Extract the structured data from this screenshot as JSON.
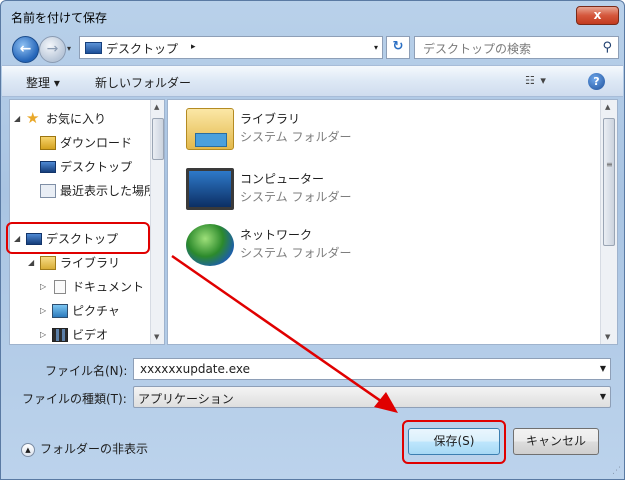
{
  "window": {
    "title": "名前を付けて保存",
    "close_glyph": "x"
  },
  "address": {
    "location": "デスクトップ",
    "arrow": "▸",
    "dropdown": "▾",
    "refresh": "↻",
    "back": "←",
    "forward": "→",
    "history": "▾"
  },
  "search": {
    "placeholder": "デスクトップの検索",
    "icon": "search-icon"
  },
  "toolbar": {
    "organize": "整理 ▾",
    "new_folder": "新しいフォルダー",
    "view": "☷ ▾",
    "help": "?"
  },
  "nav": {
    "items": [
      {
        "label": "お気に入り",
        "toggle": "◢",
        "icon": "star-icon"
      },
      {
        "label": "ダウンロード",
        "icon": "downloads-icon"
      },
      {
        "label": "デスクトップ",
        "icon": "desktop-icon"
      },
      {
        "label": "最近表示した場所",
        "icon": "recent-places-icon"
      },
      {
        "label": "デスクトップ",
        "toggle": "◢",
        "icon": "desktop-icon"
      },
      {
        "label": "ライブラリ",
        "toggle": "◢",
        "icon": "library-icon"
      },
      {
        "label": "ドキュメント",
        "toggle": "▷",
        "icon": "documents-icon"
      },
      {
        "label": "ピクチャ",
        "toggle": "▷",
        "icon": "pictures-icon"
      },
      {
        "label": "ビデオ",
        "toggle": "▷",
        "icon": "videos-icon"
      }
    ],
    "scroll_up": "▲",
    "scroll_down": "▼"
  },
  "content": {
    "items": [
      {
        "name": "ライブラリ",
        "type": "システム フォルダー",
        "icon": "library-icon"
      },
      {
        "name": "コンピューター",
        "type": "システム フォルダー",
        "icon": "computer-icon"
      },
      {
        "name": "ネットワーク",
        "type": "システム フォルダー",
        "icon": "network-icon"
      }
    ],
    "grip": "≡"
  },
  "form": {
    "filename_label": "ファイル名(N):",
    "filename_value": "xxxxxxupdate.exe",
    "filetype_label": "ファイルの種類(T):",
    "filetype_value": "アプリケーション",
    "dropdown": "▼"
  },
  "footer": {
    "hide_folders": "フォルダーの非表示",
    "hide_glyph": "▲",
    "save": "保存(S)",
    "cancel": "キャンセル",
    "grip": "⋰"
  },
  "annotation": {
    "color": "#e00000"
  }
}
